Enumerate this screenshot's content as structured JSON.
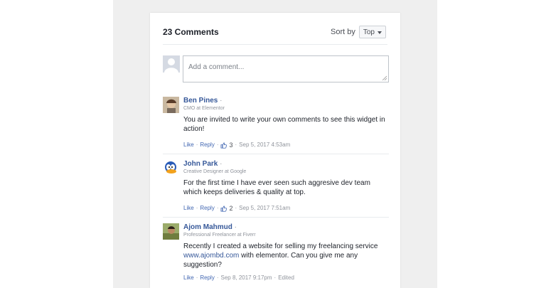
{
  "header": {
    "count": "23 Comments",
    "sort_label": "Sort by",
    "sort_value": "Top"
  },
  "composer": {
    "placeholder": "Add a comment..."
  },
  "comments": [
    {
      "name": "Ben Pines",
      "role": "CMO at Elementor",
      "text": "You are invited to write your own comments to see this widget in action!",
      "like": "Like",
      "reply": "Reply",
      "likes": "3",
      "time": "Sep 5, 2017 4:53am"
    },
    {
      "name": "John Park",
      "role": "Creative Designer at Google",
      "text": "For the first time I have ever seen such aggresive dev team which keeps deliveries & quality at top.",
      "like": "Like",
      "reply": "Reply",
      "likes": "2",
      "time": "Sep 5, 2017 7:51am"
    },
    {
      "name": "Ajom Mahmud",
      "role": "Professional Freelancer at Fiverr",
      "text_before": "Recently I created a website for selling my freelancing service ",
      "text_link": "www.ajombd.com",
      "text_after": " with elementor. Can you give me any suggestion?",
      "like": "Like",
      "reply": "Reply",
      "time": "Sep 8, 2017 9:17pm",
      "edited": "Edited"
    }
  ],
  "separator": "·",
  "colors": {
    "link": "#365899",
    "action": "#4267b2",
    "text": "#1d2129",
    "muted": "#90949c",
    "backdrop": "#efefef"
  },
  "icons": [
    "default-avatar-icon",
    "thumbs-up-icon",
    "caret-down-icon",
    "resize-grip-icon"
  ]
}
